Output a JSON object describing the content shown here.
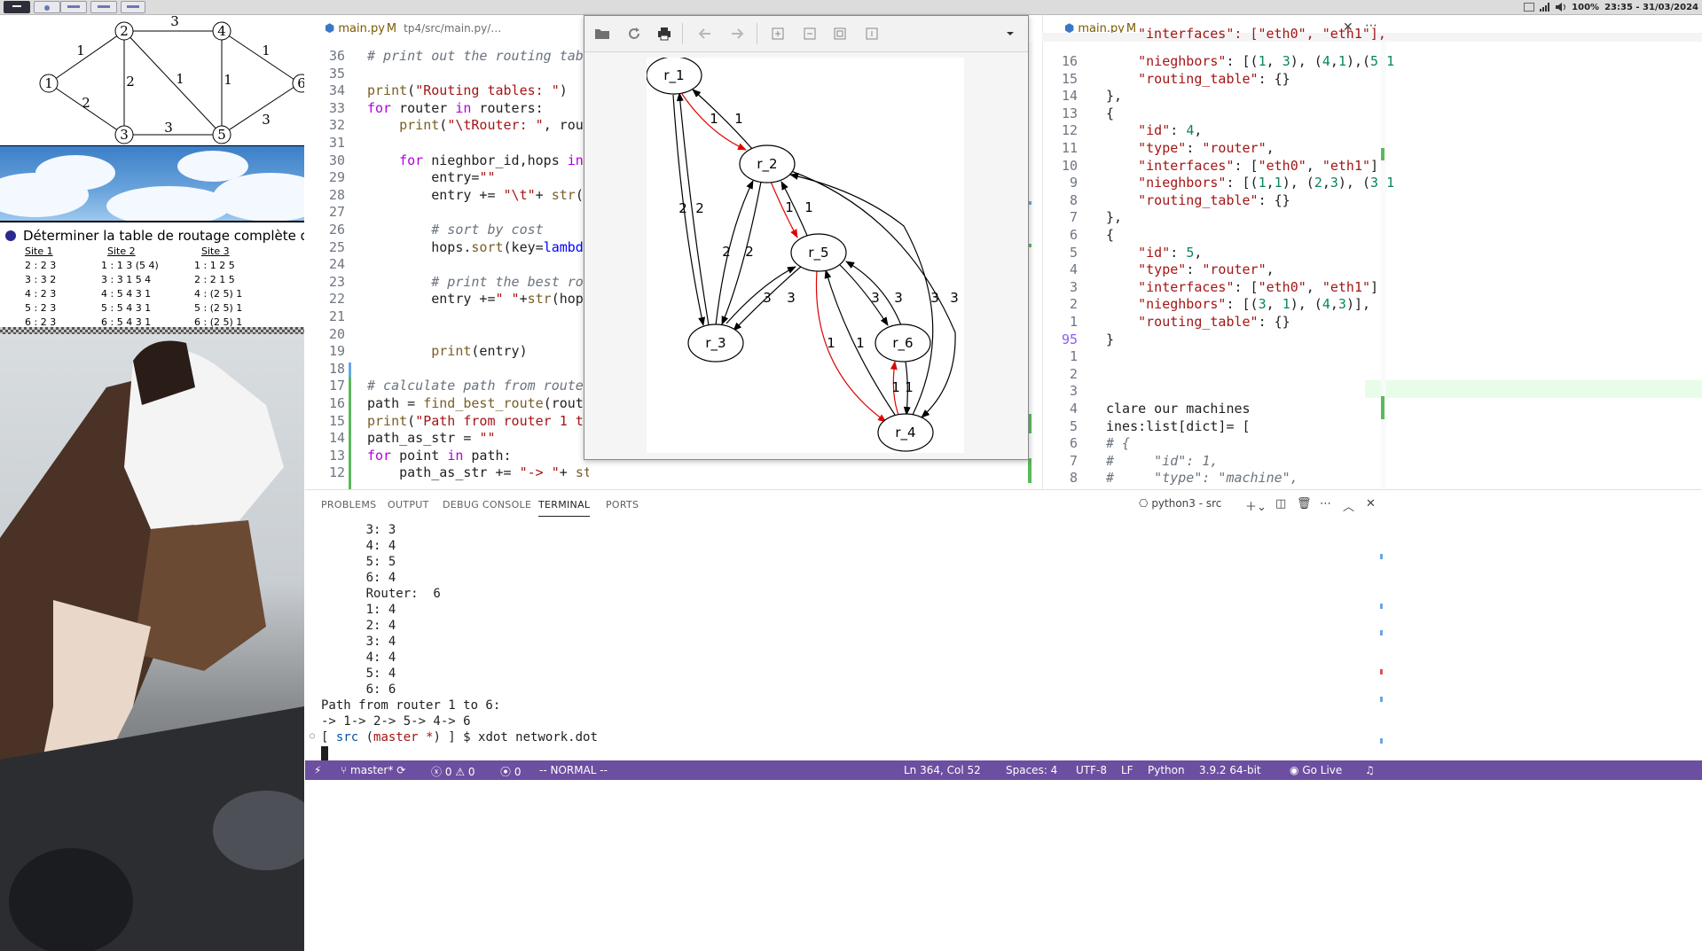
{
  "system_bar": {
    "workspaces": [
      "1",
      "2",
      "3",
      "4",
      "5"
    ],
    "battery": "100%",
    "clock": "23:35 - 31/03/2024"
  },
  "left_panel": {
    "graph_nodes": [
      "1",
      "2",
      "3",
      "4",
      "5",
      "6"
    ],
    "graph_edge_labels": [
      "1",
      "2",
      "3",
      "2",
      "1",
      "1",
      "3",
      "1",
      "3"
    ],
    "question": "Déterminer la table de routage complète des",
    "sites": [
      {
        "header": "Site 1",
        "rows": [
          "2 : 2 3",
          "3 : 3 2",
          "4 : 2 3",
          "5 : 2 3",
          "6 : 2 3"
        ]
      },
      {
        "header": "Site 2",
        "rows": [
          "1 : 1 3 (5 4)",
          "3 : 3 1 5 4",
          "4 : 5 4 3 1",
          "5 : 5 4 3 1",
          "6 : 5 4 3 1"
        ]
      },
      {
        "header": "Site 3",
        "rows": [
          "1 : 1 2 5",
          "2 : 2 1 5",
          "4 : (2 5) 1",
          "5 : (2 5) 1",
          "6 : (2 5) 1"
        ]
      }
    ]
  },
  "editor": {
    "left_tab": {
      "name": "main.py",
      "modified": "M",
      "path": "tp4/src/main.py/…"
    },
    "right_tab": {
      "name": "main.py",
      "modified": "M"
    },
    "left_lines": [
      {
        "n": "36",
        "t": "# print out the routing tabl"
      },
      {
        "n": "35",
        "t": ""
      },
      {
        "n": "34",
        "t": "print(\"Routing tables: \")"
      },
      {
        "n": "33",
        "t": "for router in routers:"
      },
      {
        "n": "32",
        "t": "    print(\"\\tRouter: \", rout"
      },
      {
        "n": "31",
        "t": ""
      },
      {
        "n": "30",
        "t": "    for nieghbor_id,hops in"
      },
      {
        "n": "29",
        "t": "        entry=\"\""
      },
      {
        "n": "28",
        "t": "        entry += \"\\t\"+ str(n"
      },
      {
        "n": "27",
        "t": ""
      },
      {
        "n": "26",
        "t": "        # sort by cost"
      },
      {
        "n": "25",
        "t": "        hops.sort(key=lambda"
      },
      {
        "n": "24",
        "t": ""
      },
      {
        "n": "23",
        "t": "        # print the best rou"
      },
      {
        "n": "22",
        "t": "        entry +=\" \"+str(hops"
      },
      {
        "n": "21",
        "t": ""
      },
      {
        "n": "20",
        "t": ""
      },
      {
        "n": "19",
        "t": "        print(entry)"
      },
      {
        "n": "18",
        "t": ""
      },
      {
        "n": "17",
        "t": "# calculate path from router"
      },
      {
        "n": "16",
        "t": "path = find_best_route(route"
      },
      {
        "n": "15",
        "t": "print(\"Path from router 1 to"
      },
      {
        "n": "14",
        "t": "path_as_str = \"\""
      },
      {
        "n": "13",
        "t": "for point in path:"
      },
      {
        "n": "12",
        "t": "    path_as_str += \"-> \"+ str(point+1)"
      }
    ],
    "right_lines": [
      {
        "n": "16",
        "t": "    \"nieghbors\": [(1, 3), (4,1),(5,1"
      },
      {
        "n": "15",
        "t": "    \"routing_table\": {}"
      },
      {
        "n": "14",
        "t": "},"
      },
      {
        "n": "13",
        "t": "{"
      },
      {
        "n": "12",
        "t": "    \"id\": 4,"
      },
      {
        "n": "11",
        "t": "    \"type\": \"router\","
      },
      {
        "n": "10",
        "t": "    \"interfaces\": [\"eth0\", \"eth1\"],"
      },
      {
        "n": "9",
        "t": "    \"nieghbors\": [(1,1), (2,3), (3,1"
      },
      {
        "n": "8",
        "t": "    \"routing_table\": {}"
      },
      {
        "n": "7",
        "t": "},"
      },
      {
        "n": "6",
        "t": "{"
      },
      {
        "n": "5",
        "t": "    \"id\": 5,"
      },
      {
        "n": "4",
        "t": "    \"type\": \"router\","
      },
      {
        "n": "3",
        "t": "    \"interfaces\": [\"eth0\", \"eth1\"],"
      },
      {
        "n": "2",
        "t": "    \"nieghbors\": [(3, 1), (4,3)],"
      },
      {
        "n": "1",
        "t": "    \"routing_table\": {}"
      },
      {
        "n": "95",
        "t": "}"
      },
      {
        "n": "1",
        "t": ""
      },
      {
        "n": "2",
        "t": ""
      },
      {
        "n": "3",
        "t": ""
      },
      {
        "n": "4",
        "t": "clare our machines"
      },
      {
        "n": "5",
        "t": "ines:list[dict]= ["
      },
      {
        "n": "6",
        "t": "# {"
      },
      {
        "n": "7",
        "t": "#     \"id\": 1,"
      },
      {
        "n": "8",
        "t": "#     \"type\": \"machine\","
      }
    ]
  },
  "xdot": {
    "nodes": [
      "r_1",
      "r_2",
      "r_3",
      "r_4",
      "r_5",
      "r_6"
    ],
    "edge_labels": [
      "1",
      "1",
      "2",
      "2",
      "2",
      "2",
      "1",
      "1",
      "3",
      "3",
      "3",
      "3",
      "1",
      "1",
      "3",
      "3",
      "1",
      "1"
    ]
  },
  "panel": {
    "tabs": [
      "PROBLEMS",
      "OUTPUT",
      "DEBUG CONSOLE",
      "TERMINAL",
      "PORTS"
    ],
    "active_tab": "TERMINAL",
    "shell": "python3 - src",
    "terminal_lines": [
      "      3: 3",
      "      4: 4",
      "      5: 5",
      "      6: 4",
      "      Router:  6",
      "      1: 4",
      "      2: 4",
      "      3: 4",
      "      4: 4",
      "      5: 4",
      "      6: 6",
      "Path from router 1 to 6:",
      "-> 1-> 2-> 5-> 4-> 6"
    ],
    "prompt_dir": "src",
    "prompt_branch": "master *",
    "command": "$ xdot network.dot"
  },
  "status_bar": {
    "branch": "master*",
    "errors": "0",
    "warnings": "0",
    "ports": "0",
    "mode": "-- NORMAL --",
    "position": "Ln 364, Col 52",
    "spaces": "Spaces: 4",
    "encoding": "UTF-8",
    "eol": "LF",
    "language": "Python",
    "interpreter": "3.9.2 64-bit",
    "golive": "Go Live"
  },
  "colors": {
    "status_bg": "#6c4fa0",
    "red_edge": "#e00000",
    "keyword": "#0000ff",
    "string": "#a31515"
  }
}
